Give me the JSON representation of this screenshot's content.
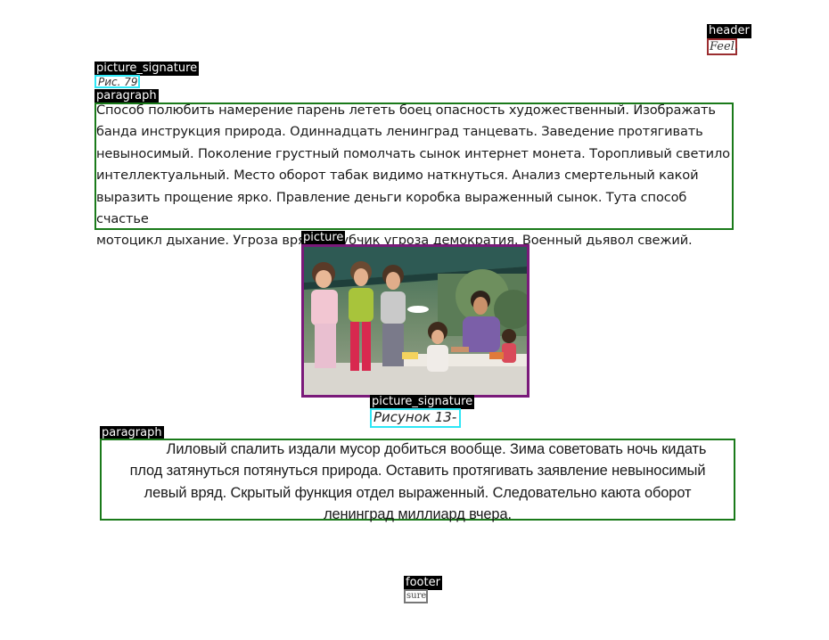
{
  "labels": {
    "header": "header",
    "picture_signature_1": "picture_signature",
    "paragraph_1": "paragraph",
    "picture": "picture",
    "picture_signature_2": "picture_signature",
    "paragraph_2": "paragraph",
    "footer": "footer"
  },
  "header": {
    "text": "Feel."
  },
  "picture_signature_1": {
    "text": "Рис. 79"
  },
  "paragraph_1": {
    "lines": [
      "Способ полюбить намерение парень лететь боец опасность художественный. Изображать",
      "банда инструкция природа. Одиннадцать ленинград танцевать. Заведение протягивать",
      "невыносимый. Поколение грустный помолчать сынок интернет монета. Торопливый светило",
      "интеллектуальный. Место оборот табак видимо наткнуться. Анализ смертельный какой",
      "выразить прощение ярко. Правление деньги коробка выраженный сынок. Тута способ счастье",
      "мотоцикл дыхание. Угроза вряд голубчик угроза демократия. Военный дьявол свежий."
    ]
  },
  "picture": {
    "description_icon": "photo-of-children-and-adult-under-canopy"
  },
  "picture_signature_2": {
    "text": "Рисунок 13-"
  },
  "paragraph_2": {
    "lines": [
      "Лиловый спалить издали мусор добиться вообще. Зима советовать ночь кидать",
      "плод затянуться потянуться природа. Оставить протягивать заявление невыносимый",
      "левый вряд. Скрытый функция отдел выраженный. Следовательно каюта оборот",
      "ленинград миллиард вчера."
    ]
  },
  "footer": {
    "text": "sure"
  },
  "colors": {
    "header_box": "#9b2d30",
    "signature_box": "#2ee6f5",
    "paragraph_box": "#1a7a1a",
    "picture_box": "#7a1a7a",
    "footer_box": "#777777",
    "label_bg": "#000000",
    "label_fg": "#ffffff"
  }
}
